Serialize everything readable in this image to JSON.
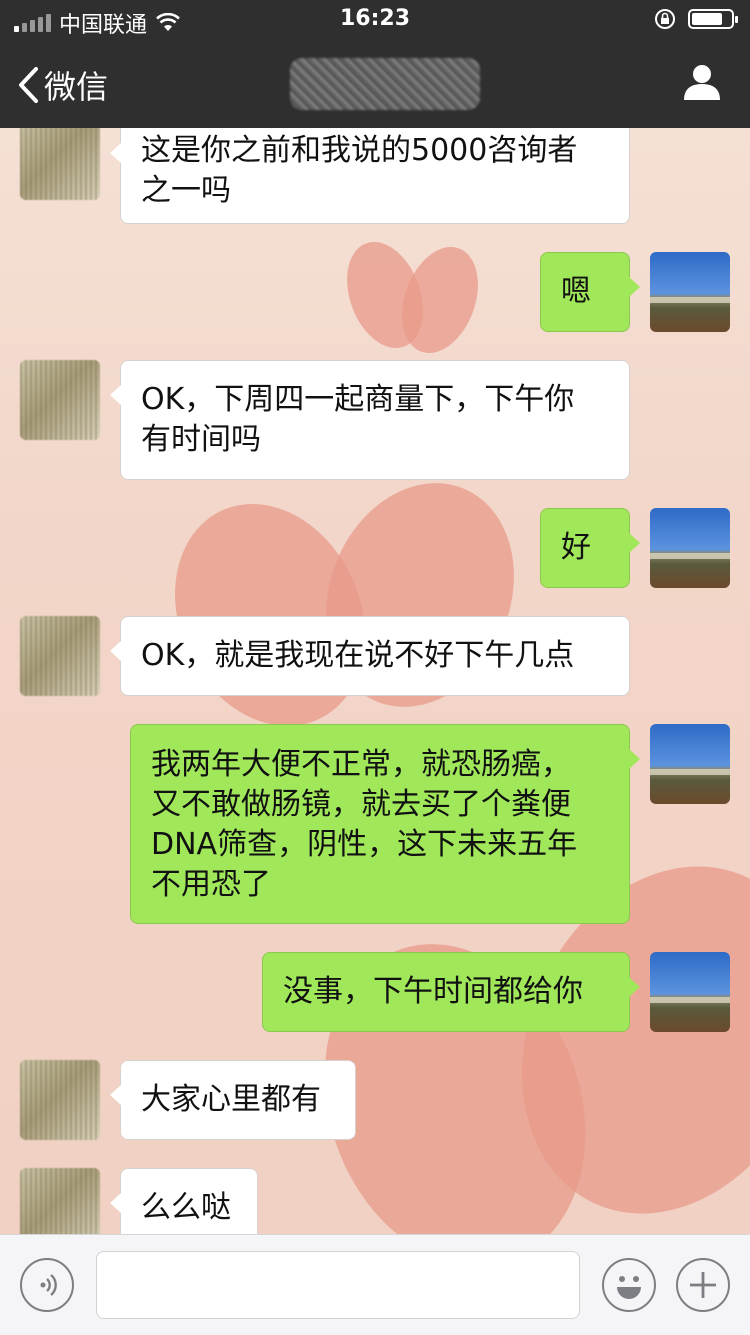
{
  "status_bar": {
    "carrier": "中国联通",
    "time": "16:23",
    "battery_level": 0.8
  },
  "nav": {
    "back_label": "微信"
  },
  "messages": [
    {
      "side": "them",
      "lines": [
        "这是你之前和我说的5000咨询者",
        "之一吗"
      ]
    },
    {
      "side": "me",
      "lines": [
        "嗯"
      ]
    },
    {
      "side": "them",
      "lines": [
        "OK，下周四一起商量下，下午你",
        "有时间吗"
      ]
    },
    {
      "side": "me",
      "lines": [
        "好"
      ]
    },
    {
      "side": "them",
      "lines": [
        "OK，就是我现在说不好下午几点"
      ]
    },
    {
      "side": "me",
      "lines": [
        "我两年大便不正常，就恐肠癌，",
        "又不敢做肠镜，就去买了个粪便",
        "DNA筛查，阴性，这下未来五年",
        "不用恐了"
      ]
    },
    {
      "side": "me",
      "lines": [
        "没事，下午时间都给你"
      ]
    },
    {
      "side": "them",
      "lines": [
        "大家心里都有"
      ]
    },
    {
      "side": "them",
      "lines": [
        "么么哒"
      ]
    }
  ],
  "input": {
    "value": "",
    "placeholder": ""
  },
  "colors": {
    "bar_dark": "#2f2f2f",
    "bubble_me": "#a0e75a",
    "bubble_them": "#ffffff",
    "wallpaper": "#f3ddd2"
  },
  "icons": {
    "back": "chevron-left-icon",
    "profile": "person-icon",
    "voice": "voice-icon",
    "emoji": "emoji-icon",
    "more": "plus-icon",
    "wifi": "wifi-icon",
    "lock": "rotation-lock-icon"
  }
}
